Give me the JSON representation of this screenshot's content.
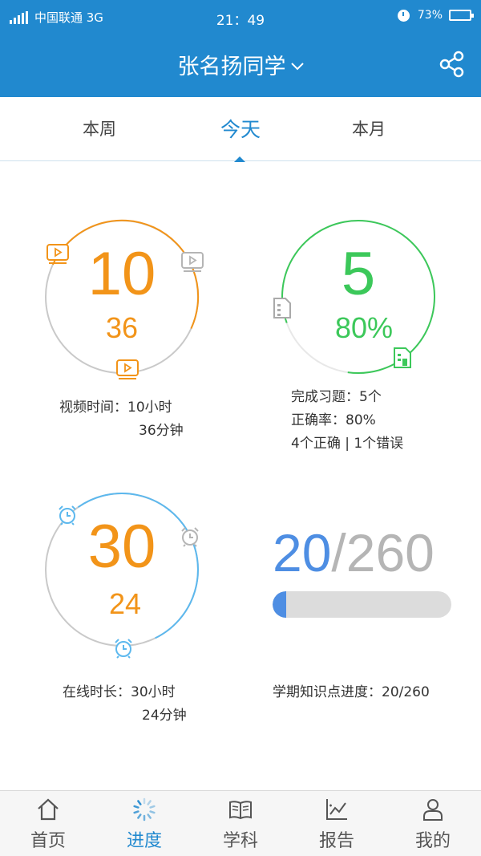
{
  "status_bar": {
    "carrier": "中国联通 3G",
    "time": "21：49",
    "battery": "73%",
    "battery_level": 0.73
  },
  "header": {
    "title": "张名扬同学",
    "share_icon": "share-icon",
    "dropdown_icon": "chevron-down-icon"
  },
  "tabs": [
    {
      "label": "本周",
      "active": false
    },
    {
      "label": "今天",
      "active": true
    },
    {
      "label": "本月",
      "active": false
    }
  ],
  "video": {
    "big": "10",
    "small": "36",
    "label": "视频时间：",
    "line1": "10小时",
    "line2": "36分钟",
    "icon": "video-play-icon",
    "color": "#f29419",
    "progress": 0.36
  },
  "exercise": {
    "big": "5",
    "small": "80%",
    "line1": "完成习题：5个",
    "line2": "正确率：80%",
    "line3": "4个正确 | 1个错误",
    "icon": "document-icon",
    "color": "#3cc85a",
    "progress": 0.8
  },
  "online": {
    "big": "30",
    "small": "24",
    "label": "在线时长：",
    "line1": "30小时",
    "line2": "24分钟",
    "icon": "alarm-clock-icon",
    "color_big": "#f29419",
    "color_ring": "#5cb8ee",
    "progress": 0.4
  },
  "knowledge": {
    "done": "20",
    "sep_total": "/260",
    "label": "学期知识点进度：20/260",
    "fraction": 0.077,
    "color": "#4e8ee3"
  },
  "nav": [
    {
      "label": "首页",
      "icon": "home-icon",
      "active": false
    },
    {
      "label": "进度",
      "icon": "progress-spinner-icon",
      "active": true
    },
    {
      "label": "学科",
      "icon": "book-icon",
      "active": false
    },
    {
      "label": "报告",
      "icon": "chart-icon",
      "active": false
    },
    {
      "label": "我的",
      "icon": "user-icon",
      "active": false
    }
  ]
}
